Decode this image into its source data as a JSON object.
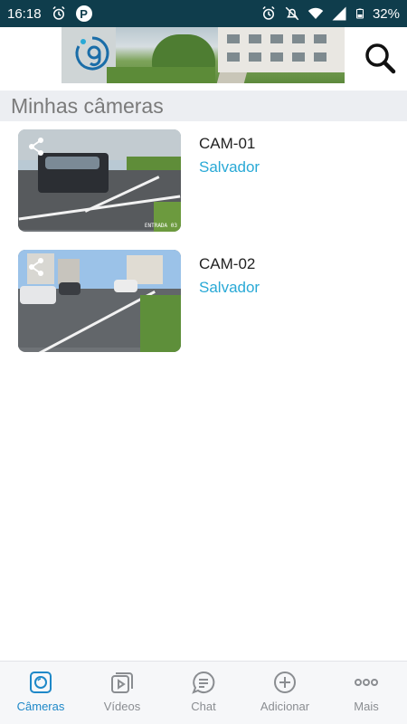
{
  "status_bar": {
    "time": "16:18",
    "battery": "32%",
    "left_icons": [
      "alarm-icon",
      "parking-app-icon"
    ],
    "right_icons": [
      "alarm-icon",
      "notifications-off-icon",
      "wifi-icon",
      "signal-icon",
      "battery-icon"
    ]
  },
  "app_bar": {
    "banner_icon": "company-logo",
    "search_icon": "search-icon"
  },
  "section": {
    "title": "Minhas câmeras"
  },
  "cameras": [
    {
      "name": "CAM-01",
      "city": "Salvador",
      "share_icon": "share-icon",
      "osd_text": "ENTRADA 03"
    },
    {
      "name": "CAM-02",
      "city": "Salvador",
      "share_icon": "share-icon"
    }
  ],
  "bottom_nav": {
    "items": [
      {
        "label": "Câmeras",
        "icon": "camera-icon",
        "active": true
      },
      {
        "label": "Vídeos",
        "icon": "videos-icon",
        "active": false
      },
      {
        "label": "Chat",
        "icon": "chat-icon",
        "active": false
      },
      {
        "label": "Adicionar",
        "icon": "add-icon",
        "active": false
      },
      {
        "label": "Mais",
        "icon": "more-icon",
        "active": false
      }
    ]
  },
  "colors": {
    "status_bar": "#0f3d4c",
    "accent": "#1e88c8",
    "city_text": "#29a9d6",
    "section_bg": "#eceef2"
  }
}
